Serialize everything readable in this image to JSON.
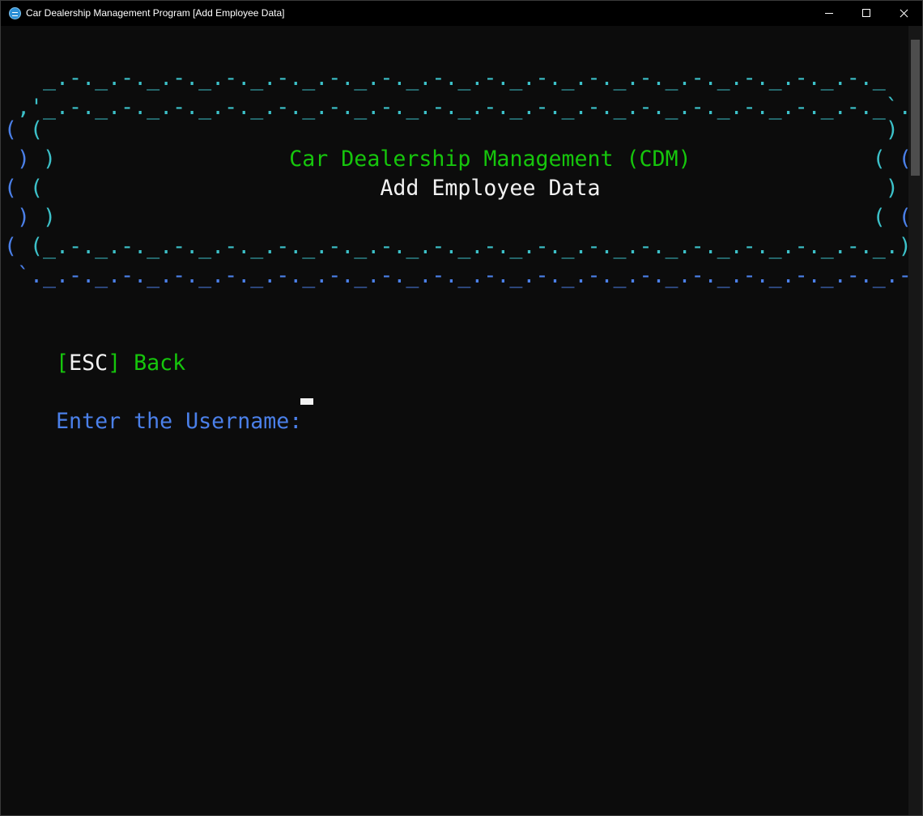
{
  "window": {
    "title": "Car Dealership Management Program [Add Employee Data]"
  },
  "banner": {
    "lines": [
      {
        "segments": [
          {
            "text": "   _.-._.-._.-._.-._.-._.-._.-._.-._.-._.-._.-._.-._.-._.-._.-._.-._",
            "tone": "cyan"
          }
        ]
      },
      {
        "segments": [
          {
            "text": " ,'_.-._.-._.-._.-._.-._.-._.-._.-._.-._.-._.-._.-._.-._.-._.-._.-._`.",
            "tone": "cyan"
          }
        ]
      },
      {
        "segments": [
          {
            "text": "( ",
            "tone": "blue"
          },
          {
            "text": "(                                                                 )",
            "tone": "cyan"
          },
          {
            "text": " )",
            "tone": "blue"
          }
        ]
      },
      {
        "segments": [
          {
            "text": " ) ",
            "tone": "blue"
          },
          {
            "text": ")",
            "tone": "cyan"
          },
          {
            "text": "                  Car Dealership Management (CDM)              ",
            "tone": "green"
          },
          {
            "text": "(",
            "tone": "cyan"
          },
          {
            "text": " (",
            "tone": "blue"
          }
        ]
      },
      {
        "segments": [
          {
            "text": "( ",
            "tone": "blue"
          },
          {
            "text": "(",
            "tone": "cyan"
          },
          {
            "text": "                          Add Employee Data                      ",
            "tone": "white"
          },
          {
            "text": ")",
            "tone": "cyan"
          },
          {
            "text": " )",
            "tone": "blue"
          }
        ]
      },
      {
        "segments": [
          {
            "text": " ) ",
            "tone": "blue"
          },
          {
            "text": ")                                                               (",
            "tone": "cyan"
          },
          {
            "text": " (",
            "tone": "blue"
          }
        ]
      },
      {
        "segments": [
          {
            "text": "( ",
            "tone": "blue"
          },
          {
            "text": "(_.-._.-._.-._.-._.-._.-._.-._.-._.-._.-._.-._.-._.-._.-._.-._.-._.)",
            "tone": "cyan"
          },
          {
            "text": " )",
            "tone": "blue"
          }
        ]
      },
      {
        "segments": [
          {
            "text": " `._.-._.-._.-._.-._.-._.-._.-._.-._.-._.-._.-._.-._.-._.-._.-._.-._.-'",
            "tone": "blue"
          }
        ]
      }
    ]
  },
  "menu": {
    "esc_open": "[",
    "esc_key": "ESC",
    "esc_close": "]",
    "esc_label": " Back"
  },
  "prompt": {
    "label": "Enter the Username: "
  },
  "colors": {
    "background": "#0c0c0c",
    "cyan": "#3cc1c9",
    "blue": "#4b80e9",
    "green": "#16c60c",
    "white": "#f2f2f2"
  },
  "icons": [
    "terminal-app-icon",
    "minimize-icon",
    "maximize-icon",
    "close-icon"
  ]
}
